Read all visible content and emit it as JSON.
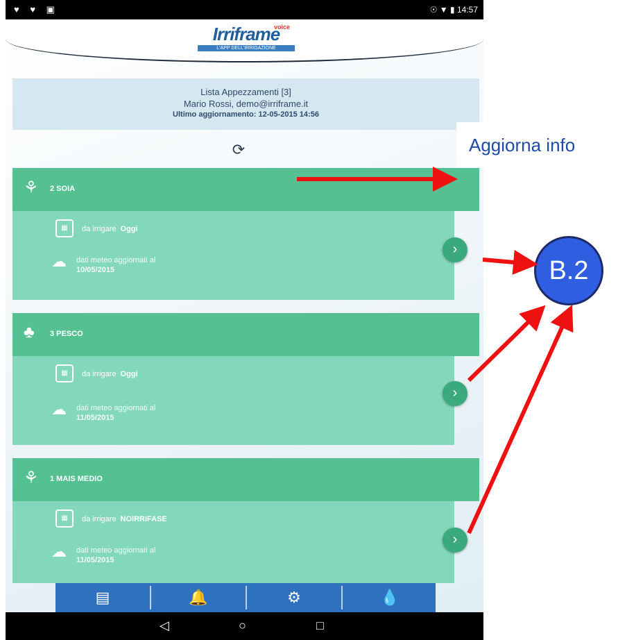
{
  "status_bar": {
    "left_icons": "♥ ♥ ▣",
    "right_text": "☉ ▼ ▮ 14:57"
  },
  "header": {
    "logo_name": "Irriframe",
    "logo_voice": "voice",
    "logo_tagline": "L'APP DELL'IRRIGAZIONE"
  },
  "info": {
    "line1": "Lista Appezzamenti [3]",
    "line2": "Mario Rossi, demo@irriframe.it",
    "line3": "Ultimo aggiornamento: 12-05-2015 14:56"
  },
  "refresh_icon": "refresh-icon",
  "cards": [
    {
      "title": "2 SOIA",
      "irrigate_label": "da irrigare",
      "irrigate_value": "Oggi",
      "meteo_label": "dati meteo aggiornati al",
      "meteo_date": "10/05/2015"
    },
    {
      "title": "3 PESCO",
      "irrigate_label": "da irrigare",
      "irrigate_value": "Oggi",
      "meteo_label": "dati meteo aggiornati al",
      "meteo_date": "11/05/2015"
    },
    {
      "title": "1 MAIS MEDIO",
      "irrigate_label": "da irrigare",
      "irrigate_value": "NOIRRIFASE",
      "meteo_label": "dati meteo aggiornati al",
      "meteo_date": "11/05/2015"
    }
  ],
  "bottom_tabs": [
    "field-icon",
    "alarm-icon",
    "settings-icon",
    "water-energy-icon"
  ],
  "annotations": {
    "aggiorna_label": "Aggiorna info",
    "b2_label": "B.2",
    "arrow_color": "#ee1111"
  },
  "colors": {
    "card_header": "#55c193",
    "card_body": "#83d7ba",
    "bottom_bar": "#2e72bf",
    "badge": "#2f5fe0"
  }
}
